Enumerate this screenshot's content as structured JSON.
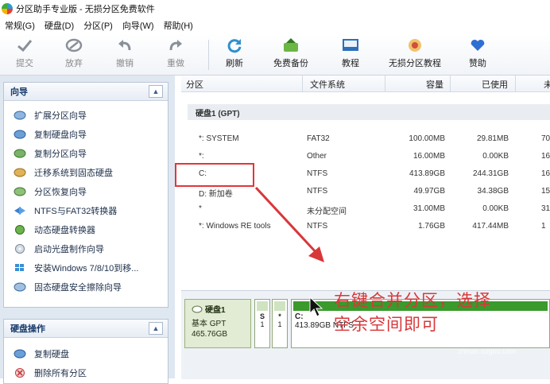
{
  "window": {
    "title": "分区助手专业版 - 无损分区免费软件"
  },
  "menu": [
    "常规(G)",
    "硬盘(D)",
    "分区(P)",
    "向导(W)",
    "帮助(H)"
  ],
  "toolbar": {
    "commit": "提交",
    "discard": "放弃",
    "undo": "撤销",
    "redo": "重做",
    "refresh": "刷新",
    "free_backup": "免费备份",
    "tutorial": "教程",
    "lossless_tutorial": "无损分区教程",
    "support": "赞助"
  },
  "wizard_panel": {
    "title": "向导",
    "items": [
      "扩展分区向导",
      "复制硬盘向导",
      "复制分区向导",
      "迁移系统到固态硬盘",
      "分区恢复向导",
      "NTFS与FAT32转换器",
      "动态硬盘转换器",
      "启动光盘制作向导",
      "安装Windows 7/8/10到移...",
      "固态硬盘安全擦除向导"
    ]
  },
  "disk_ops_panel": {
    "title": "硬盘操作",
    "items": [
      "复制硬盘",
      "删除所有分区"
    ]
  },
  "partition_table": {
    "headers": [
      "分区",
      "文件系统",
      "容量",
      "已使用",
      "未"
    ],
    "disk_label": "硬盘1 (GPT)",
    "rows": [
      {
        "name": "*: SYSTEM",
        "fs": "FAT32",
        "capacity": "100.00MB",
        "used": "29.81MB",
        "free": "70"
      },
      {
        "name": "*:",
        "fs": "Other",
        "capacity": "16.00MB",
        "used": "0.00KB",
        "free": "16"
      },
      {
        "name": "C:",
        "fs": "NTFS",
        "capacity": "413.89GB",
        "used": "244.31GB",
        "free": "169"
      },
      {
        "name": "D: 新加卷",
        "fs": "NTFS",
        "capacity": "49.97GB",
        "used": "34.38GB",
        "free": "15"
      },
      {
        "name": "*",
        "fs": "未分配空间",
        "capacity": "31.00MB",
        "used": "0.00KB",
        "free": "31"
      },
      {
        "name": "*: Windows RE tools",
        "fs": "NTFS",
        "capacity": "1.76GB",
        "used": "417.44MB",
        "free": "1"
      }
    ]
  },
  "disk_map": {
    "disk_name": "硬盘1",
    "disk_type": "基本 GPT",
    "disk_size": "465.76GB",
    "mini1_letter": "S",
    "mini1_num": "1",
    "mini2_letter": "*",
    "mini2_num": "1",
    "c_letter": "C:",
    "c_info": "413.89GB NTFS"
  },
  "annotation": {
    "line1": "右键合并分区，选择",
    "line2": "空余空间即可"
  },
  "watermark": {
    "main": "搜狗指南",
    "sub": "zhinan.sogou.com"
  },
  "colors": {
    "annotation_red": "#d8373a",
    "partition_green": "#3a9a2c"
  }
}
